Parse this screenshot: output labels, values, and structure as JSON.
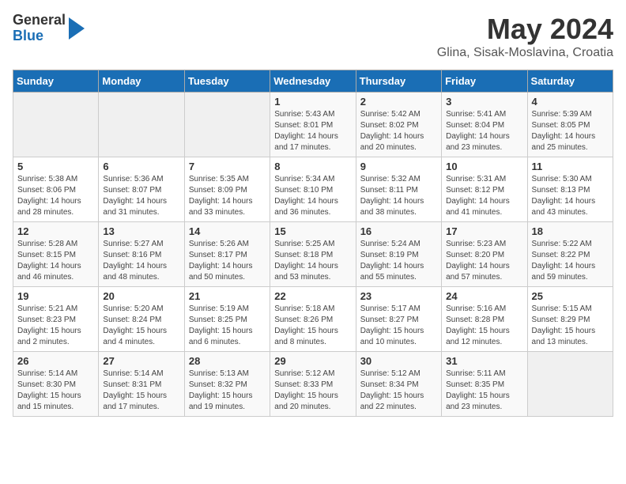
{
  "header": {
    "logo_general": "General",
    "logo_blue": "Blue",
    "title": "May 2024",
    "subtitle": "Glina, Sisak-Moslavina, Croatia"
  },
  "days_of_week": [
    "Sunday",
    "Monday",
    "Tuesday",
    "Wednesday",
    "Thursday",
    "Friday",
    "Saturday"
  ],
  "weeks": [
    [
      {
        "day": "",
        "info": ""
      },
      {
        "day": "",
        "info": ""
      },
      {
        "day": "",
        "info": ""
      },
      {
        "day": "1",
        "info": "Sunrise: 5:43 AM\nSunset: 8:01 PM\nDaylight: 14 hours and 17 minutes."
      },
      {
        "day": "2",
        "info": "Sunrise: 5:42 AM\nSunset: 8:02 PM\nDaylight: 14 hours and 20 minutes."
      },
      {
        "day": "3",
        "info": "Sunrise: 5:41 AM\nSunset: 8:04 PM\nDaylight: 14 hours and 23 minutes."
      },
      {
        "day": "4",
        "info": "Sunrise: 5:39 AM\nSunset: 8:05 PM\nDaylight: 14 hours and 25 minutes."
      }
    ],
    [
      {
        "day": "5",
        "info": "Sunrise: 5:38 AM\nSunset: 8:06 PM\nDaylight: 14 hours and 28 minutes."
      },
      {
        "day": "6",
        "info": "Sunrise: 5:36 AM\nSunset: 8:07 PM\nDaylight: 14 hours and 31 minutes."
      },
      {
        "day": "7",
        "info": "Sunrise: 5:35 AM\nSunset: 8:09 PM\nDaylight: 14 hours and 33 minutes."
      },
      {
        "day": "8",
        "info": "Sunrise: 5:34 AM\nSunset: 8:10 PM\nDaylight: 14 hours and 36 minutes."
      },
      {
        "day": "9",
        "info": "Sunrise: 5:32 AM\nSunset: 8:11 PM\nDaylight: 14 hours and 38 minutes."
      },
      {
        "day": "10",
        "info": "Sunrise: 5:31 AM\nSunset: 8:12 PM\nDaylight: 14 hours and 41 minutes."
      },
      {
        "day": "11",
        "info": "Sunrise: 5:30 AM\nSunset: 8:13 PM\nDaylight: 14 hours and 43 minutes."
      }
    ],
    [
      {
        "day": "12",
        "info": "Sunrise: 5:28 AM\nSunset: 8:15 PM\nDaylight: 14 hours and 46 minutes."
      },
      {
        "day": "13",
        "info": "Sunrise: 5:27 AM\nSunset: 8:16 PM\nDaylight: 14 hours and 48 minutes."
      },
      {
        "day": "14",
        "info": "Sunrise: 5:26 AM\nSunset: 8:17 PM\nDaylight: 14 hours and 50 minutes."
      },
      {
        "day": "15",
        "info": "Sunrise: 5:25 AM\nSunset: 8:18 PM\nDaylight: 14 hours and 53 minutes."
      },
      {
        "day": "16",
        "info": "Sunrise: 5:24 AM\nSunset: 8:19 PM\nDaylight: 14 hours and 55 minutes."
      },
      {
        "day": "17",
        "info": "Sunrise: 5:23 AM\nSunset: 8:20 PM\nDaylight: 14 hours and 57 minutes."
      },
      {
        "day": "18",
        "info": "Sunrise: 5:22 AM\nSunset: 8:22 PM\nDaylight: 14 hours and 59 minutes."
      }
    ],
    [
      {
        "day": "19",
        "info": "Sunrise: 5:21 AM\nSunset: 8:23 PM\nDaylight: 15 hours and 2 minutes."
      },
      {
        "day": "20",
        "info": "Sunrise: 5:20 AM\nSunset: 8:24 PM\nDaylight: 15 hours and 4 minutes."
      },
      {
        "day": "21",
        "info": "Sunrise: 5:19 AM\nSunset: 8:25 PM\nDaylight: 15 hours and 6 minutes."
      },
      {
        "day": "22",
        "info": "Sunrise: 5:18 AM\nSunset: 8:26 PM\nDaylight: 15 hours and 8 minutes."
      },
      {
        "day": "23",
        "info": "Sunrise: 5:17 AM\nSunset: 8:27 PM\nDaylight: 15 hours and 10 minutes."
      },
      {
        "day": "24",
        "info": "Sunrise: 5:16 AM\nSunset: 8:28 PM\nDaylight: 15 hours and 12 minutes."
      },
      {
        "day": "25",
        "info": "Sunrise: 5:15 AM\nSunset: 8:29 PM\nDaylight: 15 hours and 13 minutes."
      }
    ],
    [
      {
        "day": "26",
        "info": "Sunrise: 5:14 AM\nSunset: 8:30 PM\nDaylight: 15 hours and 15 minutes."
      },
      {
        "day": "27",
        "info": "Sunrise: 5:14 AM\nSunset: 8:31 PM\nDaylight: 15 hours and 17 minutes."
      },
      {
        "day": "28",
        "info": "Sunrise: 5:13 AM\nSunset: 8:32 PM\nDaylight: 15 hours and 19 minutes."
      },
      {
        "day": "29",
        "info": "Sunrise: 5:12 AM\nSunset: 8:33 PM\nDaylight: 15 hours and 20 minutes."
      },
      {
        "day": "30",
        "info": "Sunrise: 5:12 AM\nSunset: 8:34 PM\nDaylight: 15 hours and 22 minutes."
      },
      {
        "day": "31",
        "info": "Sunrise: 5:11 AM\nSunset: 8:35 PM\nDaylight: 15 hours and 23 minutes."
      },
      {
        "day": "",
        "info": ""
      }
    ]
  ]
}
